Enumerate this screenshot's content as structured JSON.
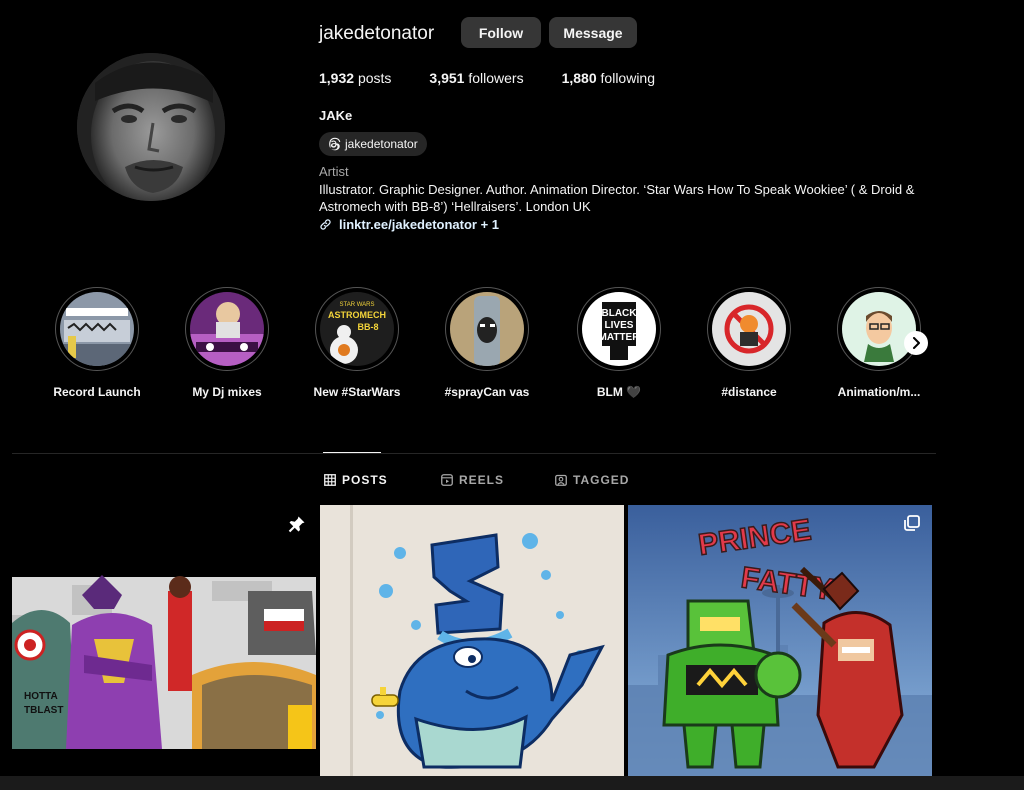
{
  "profile": {
    "username": "jakedetonator",
    "follow_label": "Follow",
    "message_label": "Message",
    "posts_count": "1,932",
    "posts_label": "posts",
    "followers_count": "3,951",
    "followers_label": "followers",
    "following_count": "1,880",
    "following_label": "following",
    "full_name": "JAKe",
    "threads_handle": "jakedetonator",
    "category": "Artist",
    "bio": "Illustrator. Graphic Designer. Author. Animation Director. ‘Star Wars How To Speak Wookiee’ ( & Droid & Astromech with BB-8’) ‘Hellraisers’. London UK",
    "link_text": "linktr.ee/jakedetonator + 1"
  },
  "highlights": [
    {
      "label": "Record Launch"
    },
    {
      "label": "My Dj mixes"
    },
    {
      "label": "New #StarWars"
    },
    {
      "label": "#sprayCan vas"
    },
    {
      "label": "BLM 🖤"
    },
    {
      "label": "#distance"
    },
    {
      "label": "Animation/m..."
    }
  ],
  "highlight_art_text": {
    "astromech_lines": [
      "STAR WARS",
      "ASTROMECH",
      "BB-8"
    ],
    "blm_lines": [
      "BLACK",
      "LIVES",
      "MATTER"
    ]
  },
  "tabs": {
    "posts": "POSTS",
    "reels": "REELS",
    "tagged": "TAGGED"
  },
  "post_art_text": {
    "post1_text": [
      "HOTTA",
      "TBLAST"
    ],
    "post2_number": "3",
    "post3_title": [
      "PRINCE",
      "FATTY"
    ]
  },
  "icons": {
    "threads": "threads-icon",
    "link": "link-icon",
    "next": "chevron-right-icon",
    "grid": "grid-icon",
    "reels": "reels-icon",
    "tagged": "tagged-icon",
    "pin": "pin-icon",
    "multi": "carousel-icon"
  }
}
